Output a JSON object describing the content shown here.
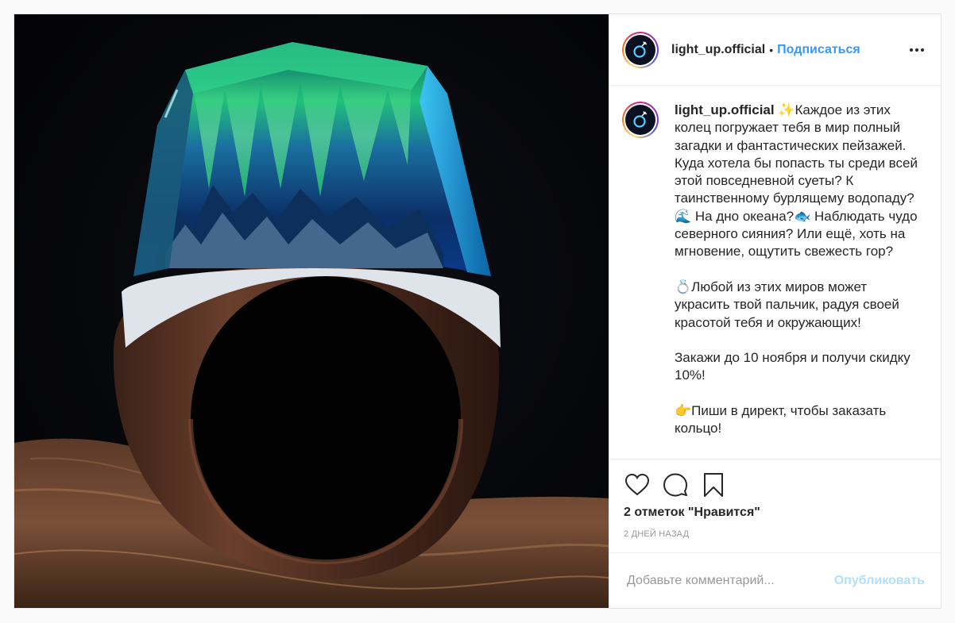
{
  "post": {
    "image_alt": "resin-wood ring with northern lights landscape",
    "author": {
      "username": "light_up.official",
      "follow_label": "Подписаться",
      "separator": "•"
    },
    "caption": {
      "username": "light_up.official",
      "text": "✨Каждое из этих колец погружает тебя в мир полный загадки и фантастических пейзажей. Куда хотела бы попасть ты среди всей этой повседневной суеты? К таинственному бурлящему водопаду?🌊 На дно океана?🐟 Наблюдать чудо северного сияния? Или ещё, хоть на мгновение, ощутить свежесть гор?\n\n💍Любой из этих миров может украсить твой пальчик, радуя своей красотой тебя и окружающих!\n\nЗакажи до 10 ноября и получи скидку 10%!\n\n👉Пиши в директ, чтобы заказать кольцо!"
    },
    "likes": "2 отметок \"Нравится\"",
    "time_ago": "2 дней назад",
    "comment": {
      "placeholder": "Добавьте комментарий...",
      "value": "",
      "publish_label": "Опубликовать"
    },
    "icons": {
      "like": "heart-icon",
      "comment": "comment-icon",
      "save": "bookmark-icon",
      "more": "more-options-icon"
    },
    "colors": {
      "link": "#3897f0",
      "publish_disabled": "#b2dffc",
      "muted": "#999999",
      "text": "#262626"
    }
  }
}
